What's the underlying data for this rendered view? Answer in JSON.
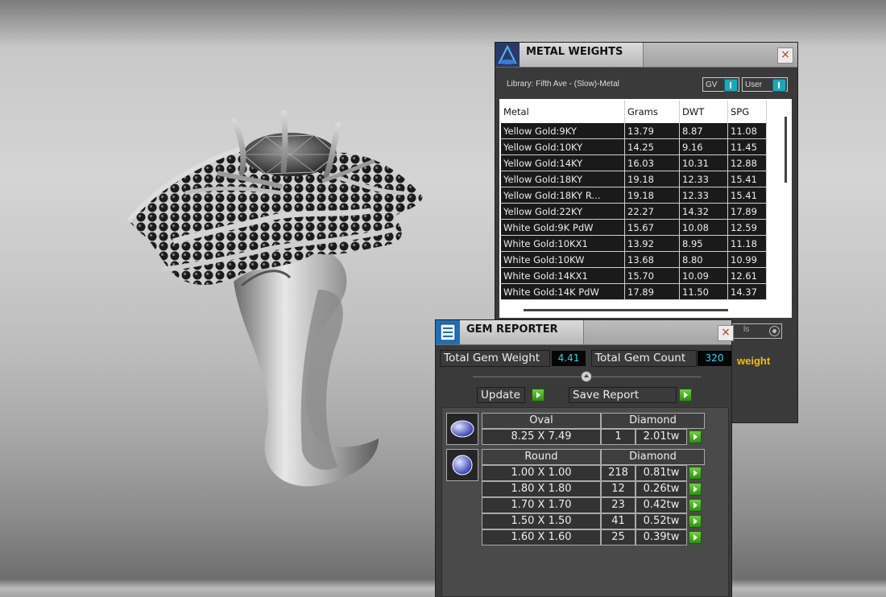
{
  "metal_weights": {
    "title": "METAL WEIGHTS",
    "close_glyph": "×",
    "library_label": "Library: Fifth Ave - (Slow)-Metal",
    "toggle_gv": "GV",
    "toggle_user": "User",
    "hidden_toggle_label": "ls",
    "columns": [
      "Metal",
      "Grams",
      "DWT",
      "SPG"
    ],
    "rows": [
      [
        "Yellow Gold:9KY",
        "13.79",
        "8.87",
        "11.08"
      ],
      [
        "Yellow Gold:10KY",
        "14.25",
        "9.16",
        "11.45"
      ],
      [
        "Yellow Gold:14KY",
        "16.03",
        "10.31",
        "12.88"
      ],
      [
        "Yellow Gold:18KY",
        "19.18",
        "12.33",
        "15.41"
      ],
      [
        "Yellow Gold:18KY R...",
        "19.18",
        "12.33",
        "15.41"
      ],
      [
        "Yellow Gold:22KY",
        "22.27",
        "14.32",
        "17.89"
      ],
      [
        "White Gold:9K PdW",
        "15.67",
        "10.08",
        "12.59"
      ],
      [
        "White Gold:10KX1",
        "13.92",
        "8.95",
        "11.18"
      ],
      [
        "White Gold:10KW",
        "13.68",
        "8.80",
        "10.99"
      ],
      [
        "White Gold:14KX1",
        "15.70",
        "10.09",
        "12.61"
      ],
      [
        "White Gold:14K PdW",
        "17.89",
        "11.50",
        "14.37"
      ]
    ]
  },
  "gem_reporter": {
    "title": "GEM REPORTER",
    "close_glyph": "×",
    "total_weight_label": "Total Gem Weight",
    "total_weight_value": "4.41",
    "total_count_label": "Total Gem Count",
    "total_count_value": "320",
    "weight_label": "weight",
    "update_label": "Update",
    "save_report_label": "Save Report",
    "groups": [
      {
        "shape": "Oval",
        "material": "Diamond",
        "rows": [
          {
            "size": "8.25 X 7.49",
            "count": "1",
            "weight": "2.01tw"
          }
        ]
      },
      {
        "shape": "Round",
        "material": "Diamond",
        "rows": [
          {
            "size": "1.00 X 1.00",
            "count": "218",
            "weight": "0.81tw"
          },
          {
            "size": "1.80 X 1.80",
            "count": "12",
            "weight": "0.26tw"
          },
          {
            "size": "1.70 X 1.70",
            "count": "23",
            "weight": "0.42tw"
          },
          {
            "size": "1.50 X 1.50",
            "count": "41",
            "weight": "0.52tw"
          },
          {
            "size": "1.60 X 1.60",
            "count": "25",
            "weight": "0.39tw"
          }
        ]
      }
    ]
  },
  "colors": {
    "dialog_bg": "#3a3a3a",
    "accent_cyan": "#2bd3f0",
    "weight_yellow": "#f5c000",
    "go_green": "#3aa81c"
  }
}
